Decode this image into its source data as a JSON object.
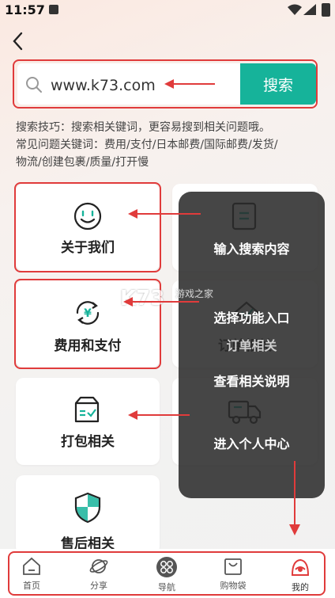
{
  "status_bar": {
    "time": "11:57"
  },
  "search": {
    "value": "www.k73.com",
    "button_label": "搜索"
  },
  "tips": {
    "line1": "搜索技巧：搜索相关键词，更容易搜到相关问题哦。",
    "line2": "常见问题关键词：费用/支付/日本邮费/国际邮费/发货/",
    "line3": "物流/创建包裹/质量/打开慢"
  },
  "cards": {
    "about": "关于我们",
    "fee": "费用和支付",
    "order": "订单相关",
    "pack": "打包相关",
    "after_sale": "售后相关"
  },
  "overlay": {
    "step1": "输入搜索内容",
    "step2": "选择功能入口",
    "step3": "查看相关说明",
    "step4": "进入个人中心"
  },
  "watermark": {
    "site": "游戏之家"
  },
  "bottom_nav": {
    "items": [
      {
        "label": "首页"
      },
      {
        "label": "分享"
      },
      {
        "label": "导航"
      },
      {
        "label": "购物袋"
      },
      {
        "label": "我的"
      }
    ]
  },
  "colors": {
    "accent": "#16b39a",
    "annotation": "#e03b3b"
  }
}
